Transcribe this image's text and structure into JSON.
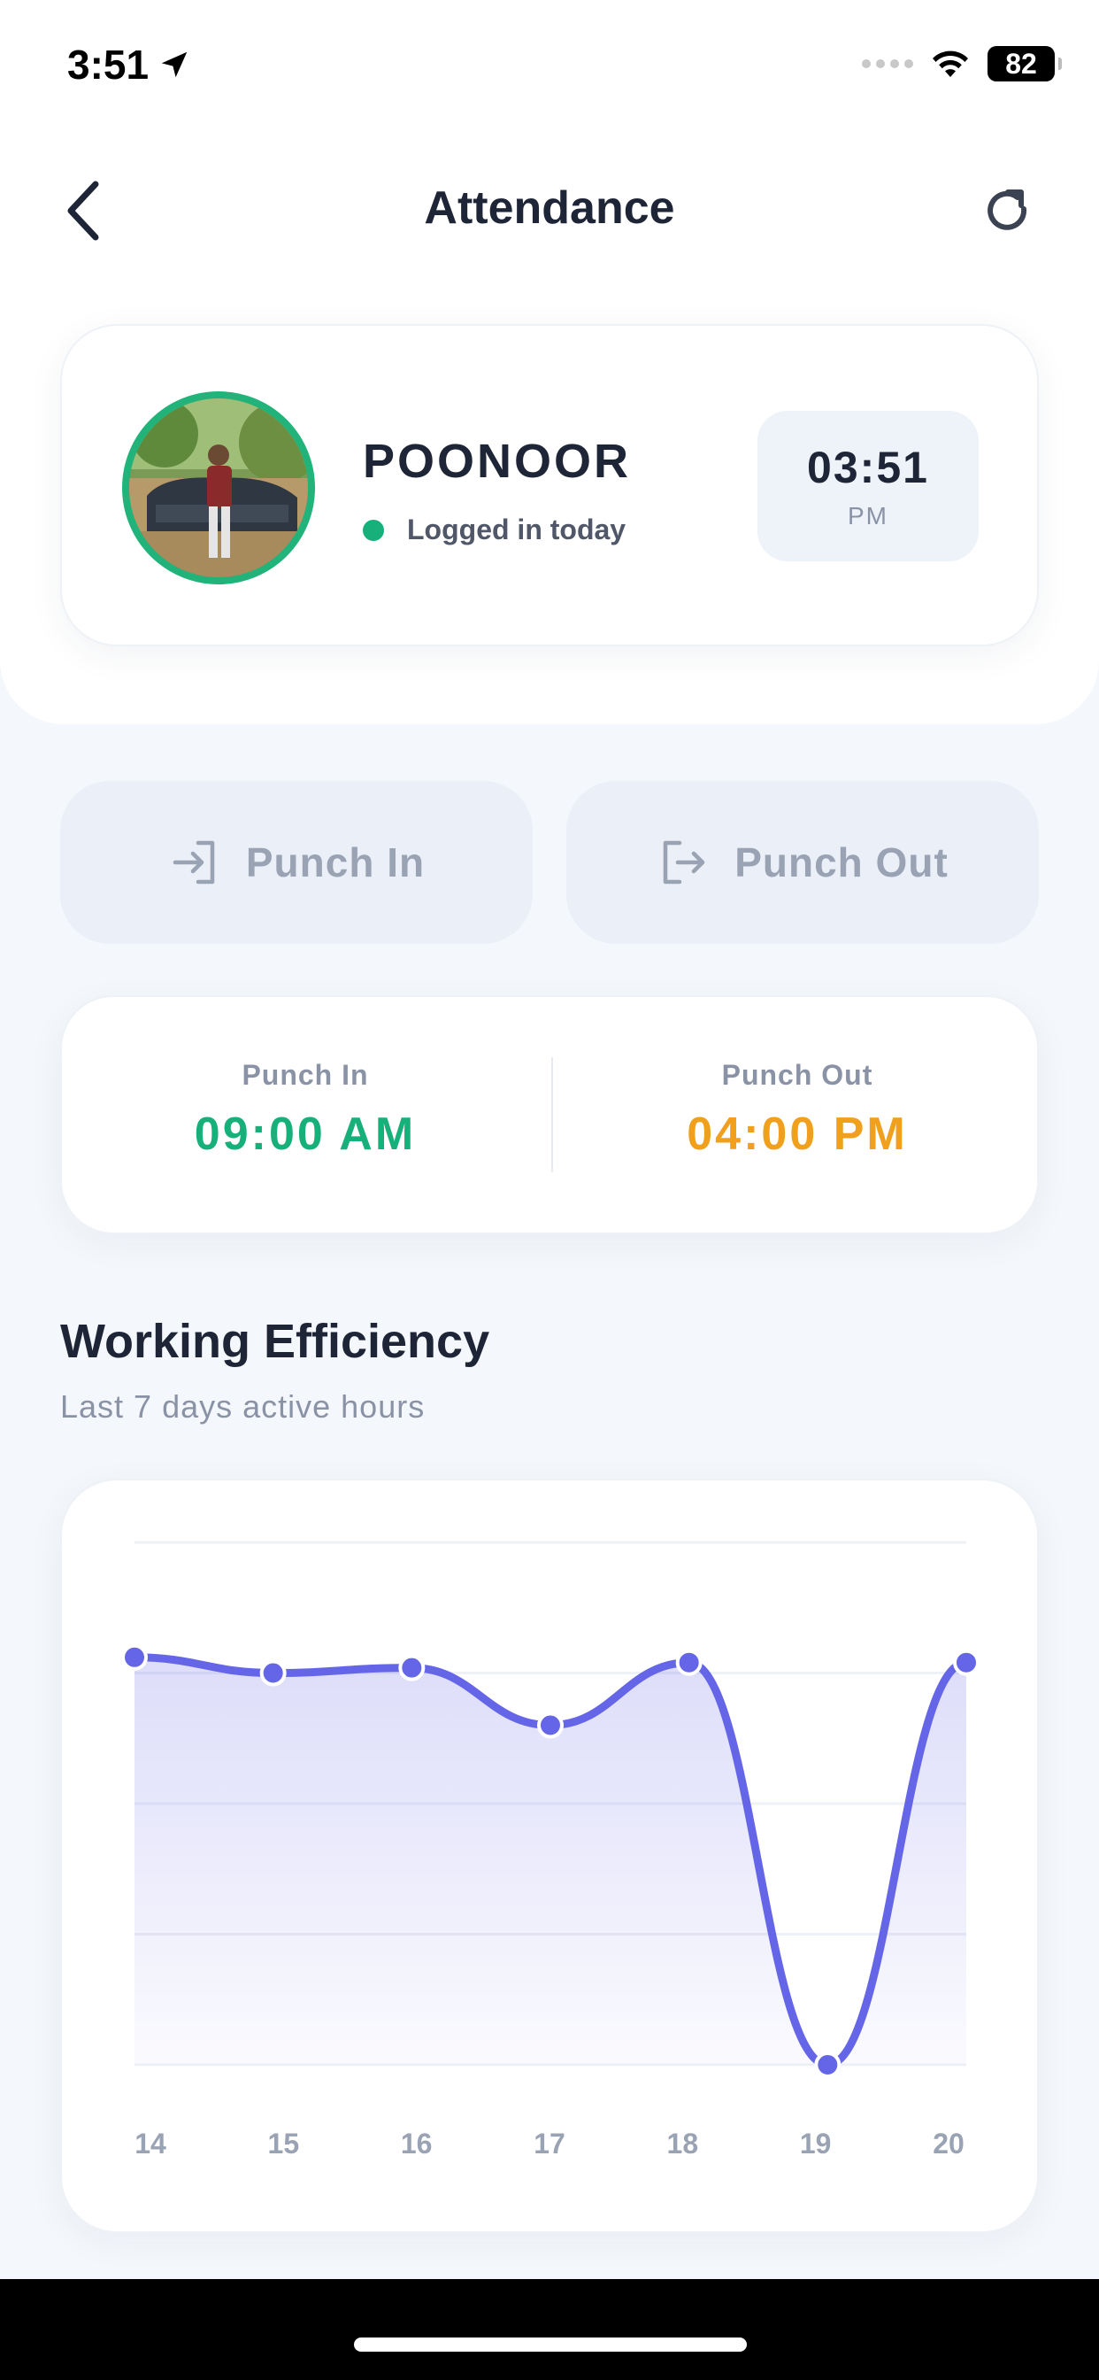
{
  "status_bar": {
    "time": "3:51",
    "battery": "82"
  },
  "header": {
    "title": "Attendance"
  },
  "profile": {
    "name": "POONOOR",
    "status": "Logged in today",
    "clock_time": "03:51",
    "clock_ampm": "PM"
  },
  "actions": {
    "punch_in_label": "Punch In",
    "punch_out_label": "Punch Out"
  },
  "times": {
    "punch_in_label": "Punch In",
    "punch_in_value": "09:00 AM",
    "punch_out_label": "Punch Out",
    "punch_out_value": "04:00 PM"
  },
  "section": {
    "title": "Working Efficiency",
    "subtitle": "Last 7 days active hours"
  },
  "colors": {
    "accent_line": "#6565e8",
    "positive": "#17b07a",
    "warning": "#f0a01c"
  },
  "chart_data": {
    "type": "area",
    "categories": [
      "14",
      "15",
      "16",
      "17",
      "18",
      "19",
      "20"
    ],
    "values": [
      7.8,
      7.5,
      7.6,
      6.5,
      7.7,
      0.0,
      7.7
    ],
    "title": "",
    "xlabel": "",
    "ylabel": "",
    "ylim": [
      0,
      10
    ],
    "grid": true,
    "legend": "none"
  }
}
